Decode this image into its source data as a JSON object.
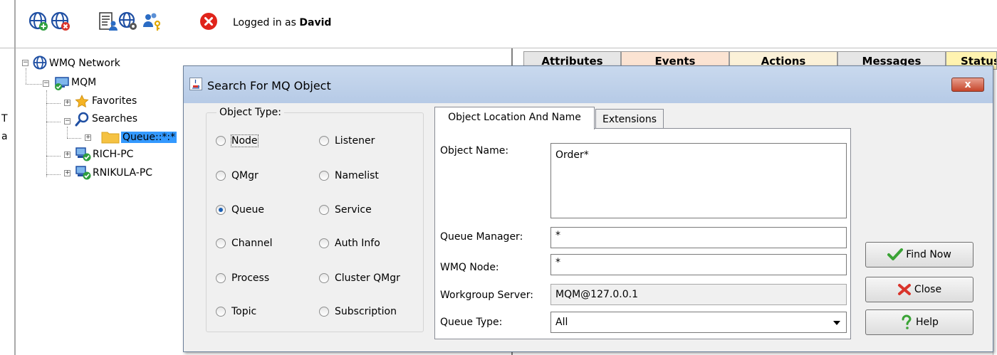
{
  "toolbar": {
    "logged_prefix": "Logged in as",
    "user": "David",
    "icons": [
      "globe-add-icon",
      "globe-remove-icon",
      "document-user-icon",
      "globe-gear-icon",
      "users-key-icon",
      "close-icon"
    ]
  },
  "tree": {
    "root": "WMQ Network",
    "mqm": "MQM",
    "favorites": "Favorites",
    "searches": "Searches",
    "queue_search": "Queue::*:*",
    "rich_pc": "RICH-PC",
    "rnikula_pc": "RNIKULA-PC",
    "cut_letters": [
      "T",
      "a"
    ]
  },
  "right_tabs": [
    "Attributes",
    "Events",
    "Actions",
    "Messages",
    "Status"
  ],
  "dialog": {
    "title": "Search For MQ Object",
    "object_type_label": "Object Type:",
    "object_types_left": [
      "Node",
      "QMgr",
      "Queue",
      "Channel",
      "Process",
      "Topic"
    ],
    "object_types_right": [
      "Listener",
      "Namelist",
      "Service",
      "Auth Info",
      "Cluster QMgr",
      "Subscription"
    ],
    "selected_type": "Queue",
    "tabs": [
      "Object Location And Name",
      "Extensions"
    ],
    "fields": {
      "object_name_label": "Object Name:",
      "object_name_value": "Order*",
      "queue_manager_label": "Queue Manager:",
      "queue_manager_value": "*",
      "wmq_node_label": "WMQ Node:",
      "wmq_node_value": "*",
      "workgroup_server_label": "Workgroup Server:",
      "workgroup_server_value": "MQM@127.0.0.1",
      "queue_type_label": "Queue Type:",
      "queue_type_value": "All"
    },
    "buttons": {
      "find_now": "Find Now",
      "close": "Close",
      "help": "Help"
    },
    "title_close": "x"
  }
}
